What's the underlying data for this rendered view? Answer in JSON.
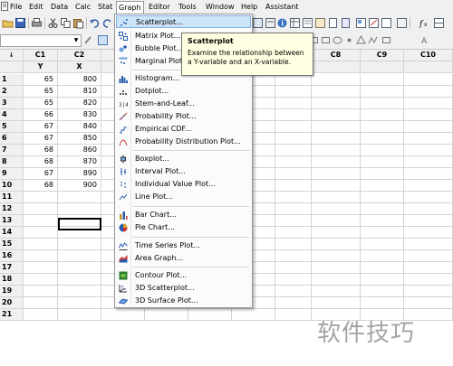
{
  "menubar": {
    "items": [
      "File",
      "Edit",
      "Data",
      "Calc",
      "Stat",
      "Graph",
      "Editor",
      "Tools",
      "Window",
      "Help",
      "Assistant"
    ],
    "active": "Graph"
  },
  "columns": {
    "ids": [
      "C1",
      "C2",
      "C8",
      "C9",
      "C10"
    ],
    "names": [
      "Y",
      "X"
    ]
  },
  "rows": [
    "1",
    "2",
    "3",
    "4",
    "5",
    "6",
    "7",
    "8",
    "9",
    "10",
    "11",
    "12",
    "13",
    "14",
    "15",
    "16",
    "17",
    "18",
    "19",
    "20",
    "21"
  ],
  "data": {
    "y": [
      "65",
      "65",
      "65",
      "66",
      "67",
      "67",
      "68",
      "68",
      "67",
      "68"
    ],
    "x": [
      "800",
      "810",
      "820",
      "830",
      "840",
      "850",
      "860",
      "870",
      "890",
      "900"
    ]
  },
  "graph_menu": {
    "items": [
      {
        "label": "Scatterplot...",
        "icon": "scatterplot-icon"
      },
      {
        "label": "Matrix Plot...",
        "icon": "matrix-plot-icon"
      },
      {
        "label": "Bubble Plot...",
        "icon": "bubble-plot-icon"
      },
      {
        "label": "Marginal Plot...",
        "icon": "marginal-plot-icon"
      },
      {
        "label": "Histogram...",
        "icon": "histogram-icon"
      },
      {
        "label": "Dotplot...",
        "icon": "dotplot-icon"
      },
      {
        "label": "Stem-and-Leaf...",
        "icon": "stem-and-leaf-icon"
      },
      {
        "label": "Probability Plot...",
        "icon": "probability-plot-icon"
      },
      {
        "label": "Empirical CDF...",
        "icon": "empirical-cdf-icon"
      },
      {
        "label": "Probability Distribution Plot...",
        "icon": "probability-distribution-icon"
      },
      {
        "label": "Boxplot...",
        "icon": "boxplot-icon"
      },
      {
        "label": "Interval Plot...",
        "icon": "interval-plot-icon"
      },
      {
        "label": "Individual Value Plot...",
        "icon": "individual-value-icon"
      },
      {
        "label": "Line Plot...",
        "icon": "line-plot-icon"
      },
      {
        "label": "Bar Chart...",
        "icon": "bar-chart-icon"
      },
      {
        "label": "Pie Chart...",
        "icon": "pie-chart-icon"
      },
      {
        "label": "Time Series Plot...",
        "icon": "time-series-icon"
      },
      {
        "label": "Area Graph...",
        "icon": "area-graph-icon"
      },
      {
        "label": "Contour Plot...",
        "icon": "contour-plot-icon"
      },
      {
        "label": "3D Scatterplot...",
        "icon": "3d-scatterplot-icon"
      },
      {
        "label": "3D Surface Plot...",
        "icon": "3d-surface-icon"
      }
    ]
  },
  "tooltip": {
    "title": "Scatterplot",
    "body": "Examine the relationship between a Y-variable and an X-variable."
  },
  "watermark": "软件技巧"
}
